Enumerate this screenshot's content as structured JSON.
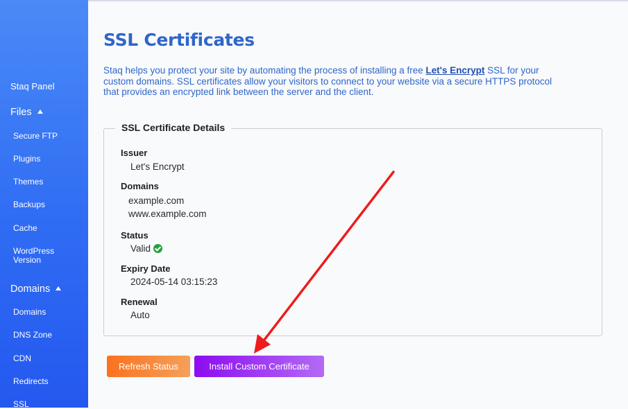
{
  "sidebar": {
    "panel_label": "Staq Panel",
    "files_label": "Files",
    "files_items": [
      "Secure FTP",
      "Plugins",
      "Themes",
      "Backups",
      "Cache",
      "WordPress Version"
    ],
    "domains_label": "Domains",
    "domains_items": [
      "Domains",
      "DNS Zone",
      "CDN",
      "Redirects",
      "SSL"
    ]
  },
  "page": {
    "title": "SSL Certificates",
    "intro_before": "Staq helps you protect your site by automating the process of installing a free ",
    "intro_link": "Let's Encrypt",
    "intro_after": " SSL for your custom domains. SSL certificates allow your visitors to connect to your website via a secure HTTPS protocol that provides an encrypted link between the server and the client."
  },
  "details": {
    "legend": "SSL Certificate Details",
    "issuer_label": "Issuer",
    "issuer_value": "Let's Encrypt",
    "domains_label": "Domains",
    "domains": [
      "example.com",
      "www.example.com"
    ],
    "status_label": "Status",
    "status_value": "Valid",
    "expiry_label": "Expiry Date",
    "expiry_value": "2024-05-14 03:15:23",
    "renewal_label": "Renewal",
    "renewal_value": "Auto"
  },
  "actions": {
    "refresh_label": "Refresh Status",
    "install_label": "Install Custom Certificate"
  },
  "colors": {
    "sidebar": "#2f6cf3",
    "title": "#2f66c9",
    "status_ok": "#27a23f",
    "refresh": "#f9721f",
    "install": "#8c0cf0",
    "annotation_arrow": "#ee1c1c"
  },
  "icons": {
    "status": "check-circle-icon",
    "section_toggle": "caret-up-icon"
  }
}
